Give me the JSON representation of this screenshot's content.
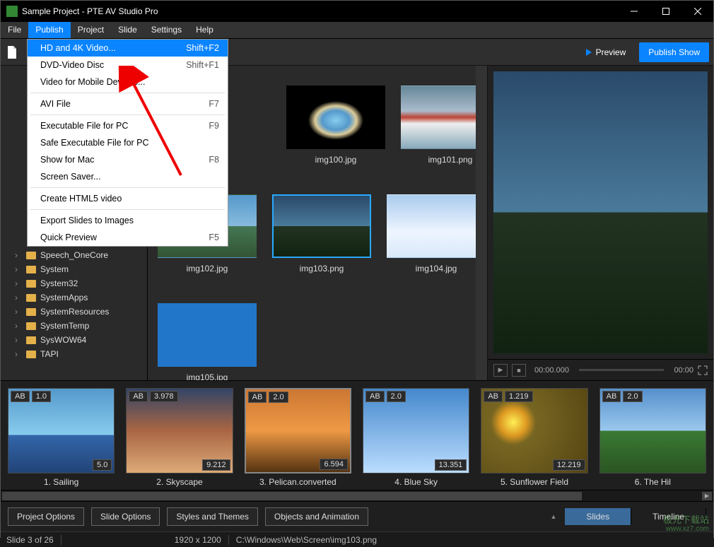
{
  "titlebar": {
    "title": "Sample Project - PTE AV Studio Pro"
  },
  "menubar": [
    "File",
    "Publish",
    "Project",
    "Slide",
    "Settings",
    "Help"
  ],
  "menubar_active": 1,
  "toolbar": {
    "preview": "Preview",
    "publish": "Publish Show"
  },
  "dropdown": [
    {
      "label": "HD and 4K Video...",
      "shortcut": "Shift+F2",
      "highlight": true
    },
    {
      "label": "DVD-Video Disc",
      "shortcut": "Shift+F1"
    },
    {
      "label": "Video for Mobile Devices..."
    },
    {
      "sep": true
    },
    {
      "label": "AVI File",
      "shortcut": "F7"
    },
    {
      "sep": true
    },
    {
      "label": "Executable File for PC",
      "shortcut": "F9"
    },
    {
      "label": "Safe Executable File for PC"
    },
    {
      "label": "Show for Mac",
      "shortcut": "F8"
    },
    {
      "label": "Screen Saver..."
    },
    {
      "sep": true
    },
    {
      "label": "Create HTML5 video"
    },
    {
      "sep": true
    },
    {
      "label": "Export Slides to Images"
    },
    {
      "label": "Quick Preview",
      "shortcut": "F5"
    }
  ],
  "tree": [
    "Speech_OneCore",
    "System",
    "System32",
    "SystemApps",
    "SystemResources",
    "SystemTemp",
    "SysWOW64",
    "TAPI"
  ],
  "thumbs": [
    {
      "name": "img100.jpg",
      "cls": "cave"
    },
    {
      "name": "img101.png",
      "cls": "wind"
    },
    {
      "name": "img102.jpg",
      "cls": ""
    },
    {
      "name": "img103.png",
      "cls": "dark",
      "selected": true
    },
    {
      "name": "img104.jpg",
      "cls": "snow"
    },
    {
      "name": "img105.jpg",
      "cls": "",
      "solid": true
    }
  ],
  "previewControls": {
    "current": "00:00.000",
    "duration": "00:00"
  },
  "slides": [
    {
      "ab": "AB",
      "in": "1.0",
      "dur": "5.0",
      "caption": "1. Sailing",
      "cls": "sails"
    },
    {
      "ab": "AB",
      "in": "3.978",
      "dur": "9.212",
      "caption": "2. Skyscape",
      "cls": "clouds"
    },
    {
      "ab": "AB",
      "in": "2.0",
      "dur": "6.594",
      "caption": "3. Pelican.converted",
      "cls": "sunset",
      "selected": true
    },
    {
      "ab": "AB",
      "in": "2.0",
      "dur": "13.351",
      "caption": "4. Blue Sky",
      "cls": "sky"
    },
    {
      "ab": "AB",
      "in": "1.219",
      "dur": "12.219",
      "caption": "5. Sunflower Field",
      "cls": "sun"
    },
    {
      "ab": "AB",
      "in": "2.0",
      "dur": "",
      "caption": "6. The Hil",
      "cls": "grass"
    }
  ],
  "buttons": {
    "projOpt": "Project Options",
    "slideOpt": "Slide Options",
    "styles": "Styles and Themes",
    "objects": "Objects and Animation"
  },
  "tabs": {
    "slides": "Slides",
    "timeline": "Timeline"
  },
  "status": {
    "slide": "Slide 3 of 26",
    "size": "1920 x 1200",
    "path": "C:\\Windows\\Web\\Screen\\img103.png"
  },
  "watermark": {
    "line1": "极光下载站",
    "line2": "www.xz7.com"
  }
}
